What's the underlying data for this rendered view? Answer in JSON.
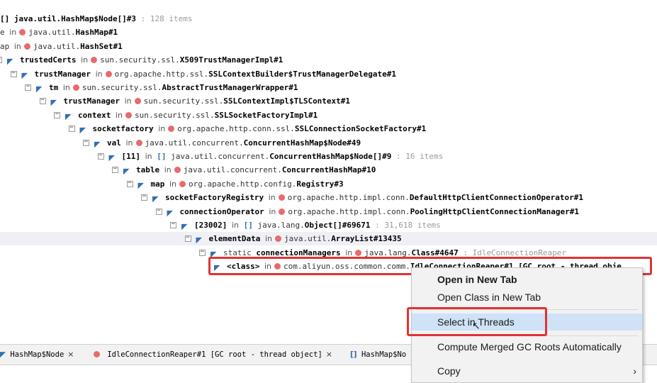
{
  "tree": [
    {
      "prefix": "",
      "name": "[] java.util.HashMap$Node[]#3",
      "meta": " : 128 items",
      "arr": true,
      "short": true
    },
    {
      "prefix": "e",
      "text": "in",
      "pkg": "java.util.",
      "cls": "HashMap#1"
    },
    {
      "prefix": "ap",
      "text": "in",
      "pkg": "java.util.",
      "cls": "HashSet#1"
    },
    {
      "field": "trustedCerts",
      "text": "in",
      "pkg": "sun.security.ssl.",
      "cls": "X509TrustManagerImpl#1"
    },
    {
      "field": "trustManager",
      "text": "in",
      "pkg": "org.apache.http.ssl.",
      "cls": "SSLContextBuilder$TrustManagerDelegate#1"
    },
    {
      "field": "tm",
      "text": "in",
      "pkg": "sun.security.ssl.",
      "cls": "AbstractTrustManagerWrapper#1"
    },
    {
      "field": "trustManager",
      "text": "in",
      "pkg": "sun.security.ssl.",
      "cls": "SSLContextImpl$TLSContext#1"
    },
    {
      "field": "context",
      "text": "in",
      "pkg": "sun.security.ssl.",
      "cls": "SSLSocketFactoryImpl#1"
    },
    {
      "field": "socketfactory",
      "text": "in",
      "pkg": "org.apache.http.conn.ssl.",
      "cls": "SSLConnectionSocketFactory#1"
    },
    {
      "field": "val",
      "text": "in",
      "pkg": "java.util.concurrent.",
      "cls": "ConcurrentHashMap$Node#49"
    },
    {
      "field": "[11]",
      "text": "in",
      "arr": true,
      "pkg": "java.util.concurrent.",
      "cls": "ConcurrentHashMap$Node[]#9",
      "meta": " : 16 items"
    },
    {
      "field": "table",
      "text": "in",
      "pkg": "java.util.concurrent.",
      "cls": "ConcurrentHashMap#10"
    },
    {
      "field": "map",
      "text": "in",
      "pkg": "org.apache.http.config.",
      "cls": "Registry#3"
    },
    {
      "field": "socketFactoryRegistry",
      "text": "in",
      "pkg": "org.apache.http.impl.conn.",
      "cls": "DefaultHttpClientConnectionOperator#1"
    },
    {
      "field": "connectionOperator",
      "text": "in",
      "pkg": "org.apache.http.impl.conn.",
      "cls": "PoolingHttpClientConnectionManager#1"
    },
    {
      "field": "[23002]",
      "text": "in",
      "arr": true,
      "pkg": "java.lang.",
      "cls": "Object[]#69671",
      "meta": " : 31,618 items"
    },
    {
      "field": "elementData",
      "text": "in",
      "pkg": "java.util.",
      "cls": "ArrayList#13435"
    },
    {
      "static": "static ",
      "field": "connectionManagers",
      "text": "in",
      "pkg": "java.lang.",
      "cls": "Class#4647",
      "meta": " : IdleConnectionReaper"
    },
    {
      "field": "<class>",
      "text": "in",
      "pkg": "com.aliyun.oss.common.comm.",
      "cls": "IdleConnectionReaper#1",
      "gc": " [GC root - thread obje"
    }
  ],
  "tabs": [
    {
      "label": "HashMap$Node",
      "close": "×"
    },
    {
      "label": "IdleConnectionReaper#1 [GC root - thread object]",
      "close": "×"
    },
    {
      "label": "HashMap$No"
    }
  ],
  "context_menu": {
    "items": [
      {
        "label": "Open in New Tab",
        "bold": true
      },
      {
        "label": "Open Class in New Tab"
      },
      {
        "label": "Select in Threads",
        "selected": true
      },
      {
        "label": "Compute Merged GC Roots Automatically"
      },
      {
        "label": "Copy",
        "submenu": "›"
      }
    ]
  },
  "colors": {
    "highlight_border": "#e23232",
    "selected_item": "#cfe2f7",
    "object_icon": "#e86a6a",
    "ref_icon": "#3a7bd5"
  }
}
